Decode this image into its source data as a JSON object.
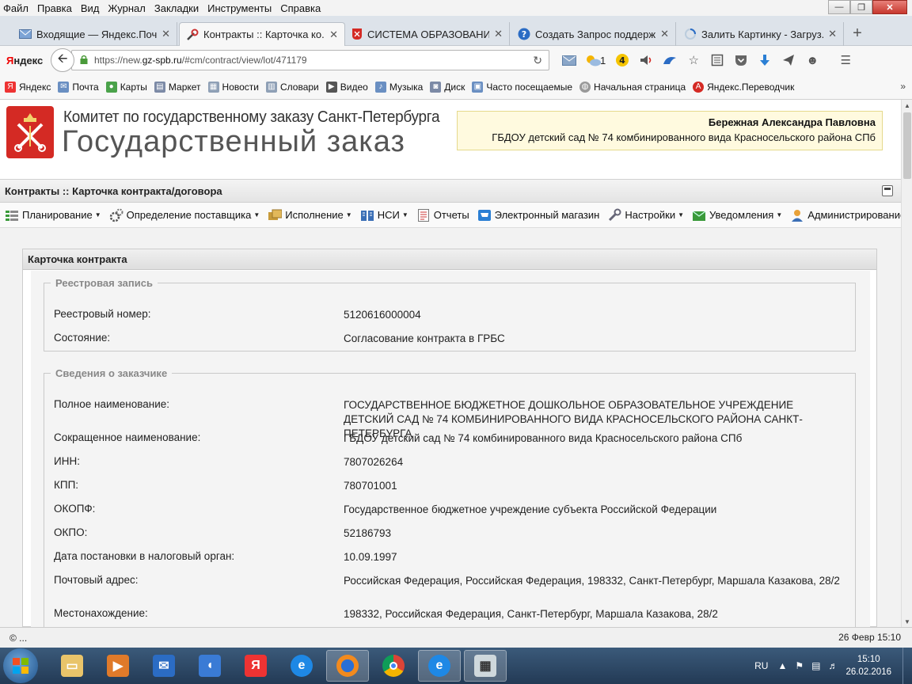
{
  "menubar": {
    "items": [
      "Файл",
      "Правка",
      "Вид",
      "Журнал",
      "Закладки",
      "Инструменты",
      "Справка"
    ]
  },
  "tabs": [
    {
      "title": "Входящие — Яндекс.Почта",
      "icon": "mail-icon",
      "active": false
    },
    {
      "title": "Контракты :: Карточка ко...",
      "icon": "tools-icon",
      "active": true
    },
    {
      "title": "СИСТЕМА ОБРАЗОВАНИ...",
      "icon": "spb-emblem-icon",
      "active": false
    },
    {
      "title": "Создать Запрос поддержк...",
      "icon": "help-icon",
      "active": false
    },
    {
      "title": "Залить Картинку - Загруз...",
      "icon": "loading-icon",
      "active": false
    }
  ],
  "nav": {
    "brand_first": "Я",
    "brand_rest": "ндекс",
    "url_prefix": "https://new.",
    "url_host": "gz-spb.ru",
    "url_path": "/#cm/contract/view/lot/471179",
    "weather_count": "1",
    "notify_count": "4"
  },
  "bookmarks": [
    "Яндекс",
    "Почта",
    "Карты",
    "Маркет",
    "Новости",
    "Словари",
    "Видео",
    "Музыка",
    "Диск",
    "Часто посещаемые",
    "Начальная страница",
    "Яндекс.Переводчик"
  ],
  "header": {
    "logo_line1": "Комитет по государственному заказу Санкт-Петербурга",
    "logo_line2": "Государственный заказ",
    "user_name": "Бережная Александра Павловна",
    "user_org": "ГБДОУ детский сад № 74 комбинированного вида Красносельского района СПб"
  },
  "page_title": "Контракты :: Карточка контракта/договора",
  "main_menu": [
    {
      "label": "Планирование",
      "icon": "planning-icon",
      "dropdown": true
    },
    {
      "label": "Определение поставщика",
      "icon": "gears-icon",
      "dropdown": true
    },
    {
      "label": "Исполнение",
      "icon": "execution-icon",
      "dropdown": true
    },
    {
      "label": "НСИ",
      "icon": "book-icon",
      "dropdown": true
    },
    {
      "label": "Отчеты",
      "icon": "report-icon",
      "dropdown": false
    },
    {
      "label": "Электронный магазин",
      "icon": "cart-icon",
      "dropdown": false
    },
    {
      "label": "Настройки",
      "icon": "wrench-icon",
      "dropdown": true
    },
    {
      "label": "Уведомления",
      "icon": "notification-icon",
      "dropdown": true
    },
    {
      "label": "Администрирование",
      "icon": "user-admin-icon",
      "dropdown": true
    }
  ],
  "card": {
    "title": "Карточка контракта",
    "registry": {
      "legend": "Реестровая запись",
      "fields": [
        {
          "label": "Реестровый номер:",
          "value": "5120616000004"
        },
        {
          "label": "Состояние:",
          "value": "Согласование контракта в ГРБС"
        }
      ]
    },
    "customer": {
      "legend": "Сведения о заказчике",
      "fields": [
        {
          "label": "Полное наименование:",
          "value": "ГОСУДАРСТВЕННОЕ БЮДЖЕТНОЕ ДОШКОЛЬНОЕ ОБРАЗОВАТЕЛЬНОЕ УЧРЕЖДЕНИЕ ДЕТСКИЙ САД № 74 КОМБИНИРОВАННОГО ВИДА КРАСНОСЕЛЬСКОГО РАЙОНА САНКТ-ПЕТЕРБУРГА"
        },
        {
          "label": "Сокращенное наименование:",
          "value": "ГБДОУ детский сад № 74 комбинированного вида Красносельского района СПб"
        },
        {
          "label": "ИНН:",
          "value": "7807026264"
        },
        {
          "label": "КПП:",
          "value": "780701001"
        },
        {
          "label": "ОКОПФ:",
          "value": "Государственное бюджетное учреждение субъекта Российской Федерации"
        },
        {
          "label": "ОКПО:",
          "value": "52186793"
        },
        {
          "label": "Дата постановки в налоговый орган:",
          "value": "10.09.1997"
        },
        {
          "label": "Почтовый адрес:",
          "value": "Российская Федерация, Российская Федерация, 198332, Санкт-Петербург, Маршала Казакова, 28/2"
        },
        {
          "label": "Местонахождение:",
          "value": "198332, Российская Федерация, Санкт-Петербург, Маршала Казакова, 28/2"
        }
      ]
    }
  },
  "status": {
    "left": "© ...",
    "right": "26 Февр 15:10"
  },
  "taskbar": {
    "apps": [
      "explorer-icon",
      "media-player-icon",
      "outlook-icon",
      "sound-icon",
      "yandex-browser-icon",
      "ie-icon",
      "firefox-icon",
      "chrome-icon",
      "ie-icon",
      "calculator-icon"
    ],
    "lang": "RU",
    "time": "15:10",
    "date": "26.02.2016"
  },
  "colors": {
    "accent_red": "#d42a24",
    "taskbar": "#2c4868",
    "userbox_bg": "#fffadf"
  }
}
